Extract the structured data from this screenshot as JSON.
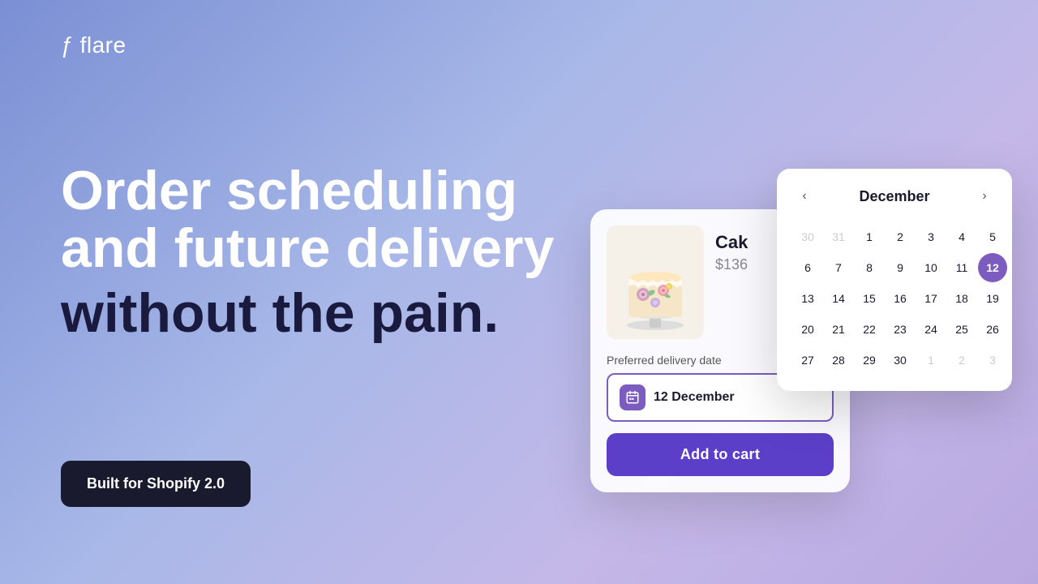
{
  "logo": {
    "icon": "ƒ",
    "text": "flare"
  },
  "headline": {
    "line1": "Order scheduling",
    "line2": "and future delivery",
    "line3": "without the pain."
  },
  "badge": {
    "label": "Built for Shopify 2.0"
  },
  "product": {
    "name": "Cak",
    "price": "$136",
    "delivery_label": "Preferred delivery date",
    "date_value": "12 December",
    "add_to_cart": "Add to cart"
  },
  "calendar": {
    "month": "December",
    "prev_label": "‹",
    "next_label": "›",
    "rows": [
      [
        "30",
        "31",
        "1",
        "2",
        "3",
        "4",
        "5"
      ],
      [
        "6",
        "7",
        "8",
        "9",
        "10",
        "11",
        "12"
      ],
      [
        "13",
        "14",
        "15",
        "16",
        "17",
        "18",
        "19"
      ],
      [
        "20",
        "21",
        "22",
        "23",
        "24",
        "25",
        "26"
      ],
      [
        "27",
        "28",
        "29",
        "30",
        "1",
        "2",
        "3"
      ]
    ],
    "other_month_indices": {
      "row0": [
        0,
        1
      ],
      "row4": [
        4,
        5,
        6
      ]
    },
    "selected_day": "12",
    "selected_row": 1,
    "selected_col": 6
  }
}
